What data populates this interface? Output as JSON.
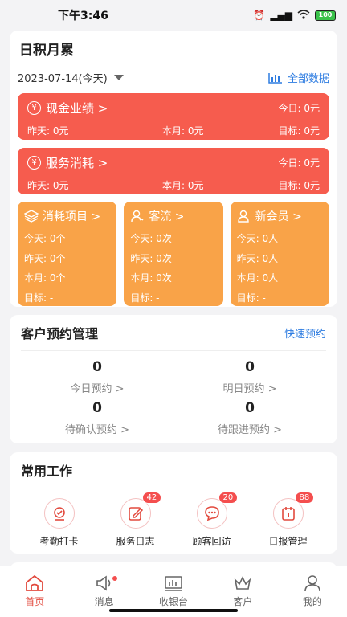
{
  "status": {
    "time": "下午3:46",
    "battery": "100"
  },
  "summary": {
    "title": "日积月累",
    "date": "2023-07-14(今天)",
    "all_data": "全部数据",
    "cash": {
      "title": "现金业绩 >",
      "today": "今日: 0元",
      "yesterday": "昨天: 0元",
      "month": "本月: 0元",
      "target": "目标: 0元"
    },
    "service": {
      "title": "服务消耗 >",
      "today": "今日: 0元",
      "yesterday": "昨天: 0元",
      "month": "本月: 0元",
      "target": "目标: 0元"
    },
    "items": {
      "title": "消耗项目 >",
      "today": "今天: 0个",
      "yesterday": "昨天: 0个",
      "month": "本月: 0个",
      "target": "目标: -"
    },
    "traffic": {
      "title": "客流 >",
      "today": "今天: 0次",
      "yesterday": "昨天: 0次",
      "month": "本月: 0次",
      "target": "目标: -"
    },
    "members": {
      "title": "新会员 >",
      "today": "今天: 0人",
      "yesterday": "昨天: 0人",
      "month": "本月: 0人",
      "target": "目标: -"
    }
  },
  "appointments": {
    "title": "客户预约管理",
    "quick": "快速预约",
    "cells": [
      {
        "num": "0",
        "label": "今日预约 >"
      },
      {
        "num": "0",
        "label": "明日预约 >"
      },
      {
        "num": "0",
        "label": "待确认预约 >"
      },
      {
        "num": "0",
        "label": "待跟进预约 >"
      }
    ]
  },
  "work": {
    "title": "常用工作",
    "items": [
      {
        "label": "考勤打卡",
        "badge": ""
      },
      {
        "label": "服务日志",
        "badge": "42"
      },
      {
        "label": "顾客回访",
        "badge": "20"
      },
      {
        "label": "日报管理",
        "badge": "88"
      }
    ]
  },
  "tabs": [
    {
      "label": "首页"
    },
    {
      "label": "消息"
    },
    {
      "label": "收银台"
    },
    {
      "label": "客户"
    },
    {
      "label": "我的"
    }
  ],
  "colors": {
    "red": "#f65c4e",
    "orange": "#f9a348",
    "accent_blue": "#2f7de1",
    "active_tab": "#e24a3e"
  }
}
